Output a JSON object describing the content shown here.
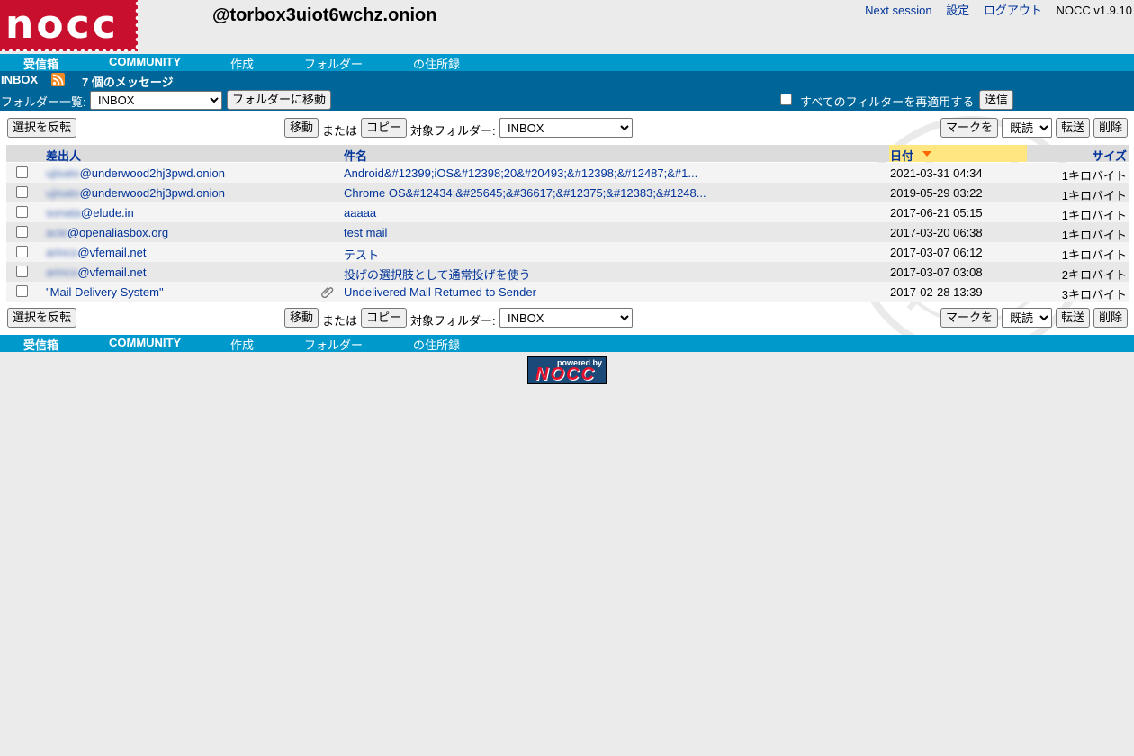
{
  "header": {
    "logo_text": "nocc",
    "account": "@torbox3uiot6wchz.onion",
    "links": {
      "next_session": "Next session",
      "settings": "設定",
      "logout": "ログアウト"
    },
    "version": "NOCC v1.9.10"
  },
  "nav": {
    "inbox": "受信箱",
    "community": "COMMUNITY",
    "compose": "作成",
    "folders": "フォルダー",
    "address_book": "の住所録"
  },
  "info": {
    "folder_name": "INBOX",
    "message_count": "7 個のメッセージ",
    "folder_list_label": "フォルダー一覧:",
    "folder_select_value": "INBOX",
    "move_to_folder_label": "フォルダーに移動",
    "reapply_filters_label": "すべてのフィルターを再適用する",
    "send_label": "送信"
  },
  "toolbar": {
    "invert_selection": "選択を反転",
    "move": "移動",
    "or": "または",
    "copy": "コピー",
    "target_folder_label": "対象フォルダー:",
    "target_folder_value": "INBOX",
    "mark": "マークを",
    "read_state": "既読",
    "forward": "転送",
    "delete": "削除"
  },
  "columns": {
    "from": "差出人",
    "subject": "件名",
    "date": "日付",
    "size": "サイズ"
  },
  "messages": [
    {
      "from_user": "ujisato",
      "from_domain": "@underwood2hj3pwd.onion",
      "subject": "Android&#12399;iOS&#12398;20&#20493;&#12398;&#12487;&#1...",
      "date": "2021-03-31 04:34",
      "size_num": "1",
      "size_unit": "キロバイト",
      "attachment": false
    },
    {
      "from_user": "ujisato",
      "from_domain": "@underwood2hj3pwd.onion",
      "subject": "Chrome OS&#12434;&#25645;&#36617;&#12375;&#12383;&#1248...",
      "date": "2019-05-29 03:22",
      "size_num": "1",
      "size_unit": "キロバイト",
      "attachment": false
    },
    {
      "from_user": "sonata",
      "from_domain": "@elude.in",
      "subject": "aaaaa",
      "date": "2017-06-21 05:15",
      "size_num": "1",
      "size_unit": "キロバイト",
      "attachment": false
    },
    {
      "from_user": "acie",
      "from_domain": "@openaliasbox.org",
      "subject": "test mail",
      "date": "2017-03-20 06:38",
      "size_num": "1",
      "size_unit": "キロバイト",
      "attachment": false
    },
    {
      "from_user": "arinco",
      "from_domain": "@vfemail.net",
      "subject": "テスト",
      "date": "2017-03-07 06:12",
      "size_num": "1",
      "size_unit": "キロバイト",
      "attachment": false
    },
    {
      "from_user": "arinco",
      "from_domain": "@vfemail.net",
      "subject": "投げの選択肢として通常投げを使う",
      "date": "2017-03-07 03:08",
      "size_num": "2",
      "size_unit": "キロバイト",
      "attachment": false
    },
    {
      "from_user": "",
      "from_domain": "\"Mail Delivery System\"",
      "subject": "Undelivered Mail Returned to Sender",
      "date": "2017-02-28 13:39",
      "size_num": "3",
      "size_unit": "キロバイト",
      "attachment": true
    }
  ],
  "footer": {
    "powered_by": "powered by",
    "powered_logo": "NOCC"
  },
  "colors": {
    "nav_bg": "#0099cc",
    "info_bg": "#006699",
    "link": "#003399",
    "date_header_bg": "#ffe680",
    "logo_red": "#c8102e"
  }
}
